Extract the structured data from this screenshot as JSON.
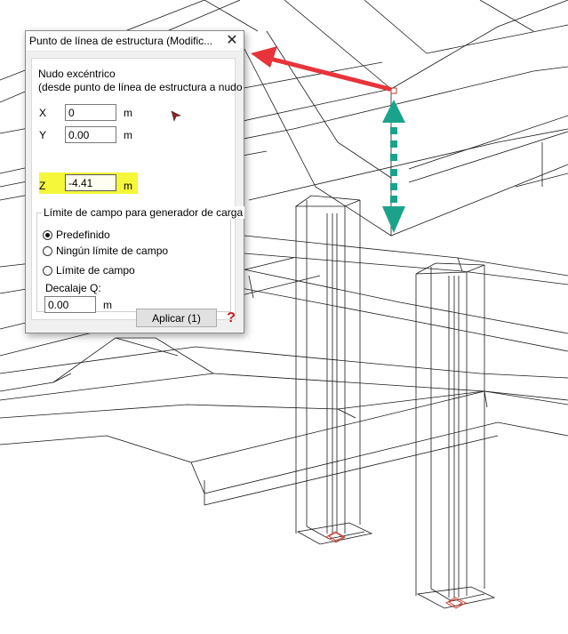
{
  "dialog": {
    "title": "Punto de línea de estructura (Modific...",
    "close_glyph": "✕",
    "section_heading": "Nudo excéntrico",
    "section_subheading": "(desde punto de línea de estructura a nudo",
    "fields": [
      {
        "label": "X",
        "value": "0",
        "unit": "m"
      },
      {
        "label": "Y",
        "value": "0.00",
        "unit": "m"
      },
      {
        "label": "Z",
        "value": "-4.41",
        "unit": "m"
      }
    ],
    "pick_icon": "pick-point-icon",
    "group": {
      "title": "Límite de campo para generador de carga",
      "options": [
        {
          "label": "Predefinido",
          "selected": true
        },
        {
          "label": "Ningún límite de campo",
          "selected": false
        },
        {
          "label": "Límite de campo",
          "selected": false
        }
      ],
      "offset_label": "Decalaje Q:",
      "offset_value": "0.00",
      "offset_unit": "m"
    },
    "apply_label": "Aplicar (1)",
    "help_glyph": "?"
  },
  "colors": {
    "annotation_arrow": "#e8333a",
    "dimension_arrow": "#1aa38a",
    "highlight": "#f4f73a",
    "node_marker": "#c0392b"
  }
}
